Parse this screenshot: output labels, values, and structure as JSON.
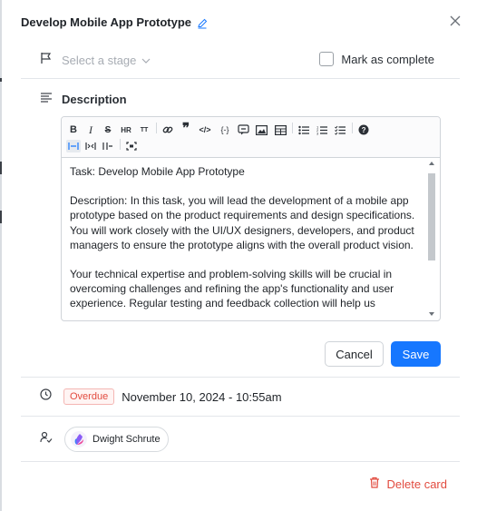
{
  "card": {
    "title": "Develop Mobile App Prototype"
  },
  "stage": {
    "placeholder": "Select a stage",
    "complete_label": "Mark as complete"
  },
  "description": {
    "heading": "Description",
    "paragraphs": [
      "Task: Develop Mobile App Prototype",
      "Description: In this task, you will lead the development of a mobile app prototype based on the product requirements and design specifications. You will work closely with the UI/UX designers, developers, and product managers to ensure the prototype aligns with the overall product vision.",
      "Your technical expertise and problem-solving skills will be crucial in overcoming challenges and refining the app's functionality and user experience. Regular testing and feedback collection will help us"
    ]
  },
  "toolbar": {
    "items": [
      "bold",
      "italic",
      "strikethrough",
      "horizontal-rule",
      "heading",
      "link",
      "quote",
      "code",
      "code-block",
      "comment",
      "image",
      "table",
      "bullet-list",
      "ordered-list",
      "checklist",
      "help",
      "side-by-side",
      "split-columns",
      "fullscreen-preview",
      "fullscreen"
    ]
  },
  "actions": {
    "cancel_label": "Cancel",
    "save_label": "Save"
  },
  "due": {
    "status": "Overdue",
    "date_text": "November 10, 2024 - 10:55am",
    "status_color": "#e24b3f"
  },
  "assignee": {
    "name": "Dwight Schrute"
  },
  "footer": {
    "delete_label": "Delete card"
  },
  "colors": {
    "accent": "#1677ff",
    "danger": "#e24b3f"
  }
}
